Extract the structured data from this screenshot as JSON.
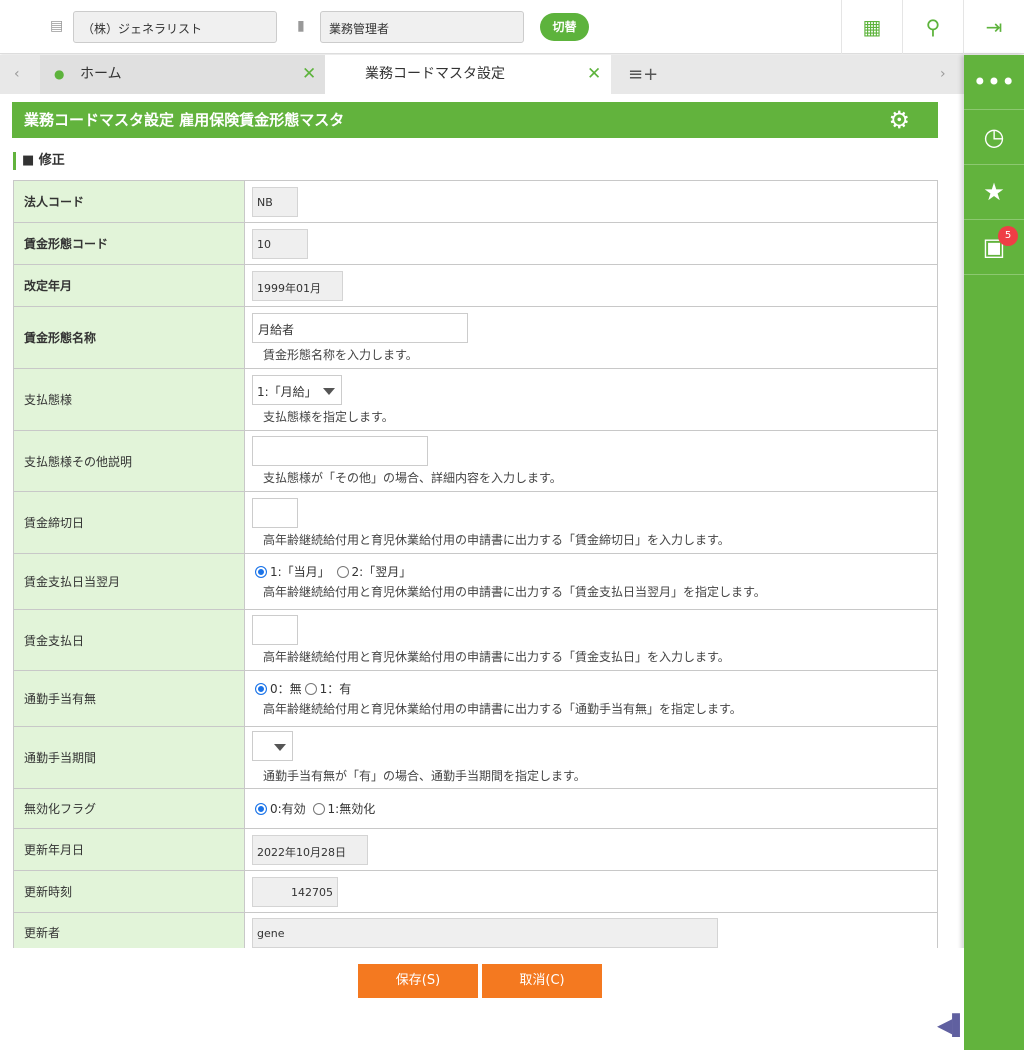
{
  "header": {
    "company": "（株）ジェネラリスト",
    "role": "業務管理者",
    "switch_label": "切替"
  },
  "tabs": [
    {
      "label": "ホーム"
    },
    {
      "label": "業務コードマスタ設定"
    }
  ],
  "sidebar": {
    "notification_count": "5"
  },
  "page": {
    "title": "業務コードマスタ設定 雇用保険賃金形態マスタ",
    "section": "■ 修正"
  },
  "form": {
    "corp_code": {
      "label": "法人コード",
      "value": "NB"
    },
    "wage_code": {
      "label": "賃金形態コード",
      "value": "10"
    },
    "revision": {
      "label": "改定年月",
      "value": "1999年01月"
    },
    "wage_name": {
      "label": "賃金形態名称",
      "value": "月給者",
      "hint": "賃金形態名称を入力します。"
    },
    "payment_mode": {
      "label": "支払態様",
      "value": "1:「月給」",
      "hint": "支払態様を指定します。"
    },
    "payment_other": {
      "label": "支払態様その他説明",
      "value": "",
      "hint": "支払態様が「その他」の場合、詳細内容を入力します。"
    },
    "closing_day": {
      "label": "賃金締切日",
      "value": "",
      "hint": "高年齢継続給付用と育児休業給付用の申請書に出力する「賃金締切日」を入力します。"
    },
    "pay_month": {
      "label": "賃金支払日当翌月",
      "options": [
        "1:「当月」",
        "2:「翌月」"
      ],
      "selected": 0,
      "hint": "高年齢継続給付用と育児休業給付用の申請書に出力する「賃金支払日当翌月」を指定します。"
    },
    "pay_day": {
      "label": "賃金支払日",
      "value": "",
      "hint": "高年齢継続給付用と育児休業給付用の申請書に出力する「賃金支払日」を入力します。"
    },
    "commute": {
      "label": "通勤手当有無",
      "options": [
        "0：無",
        "1：有"
      ],
      "selected": 0,
      "hint": "高年齢継続給付用と育児休業給付用の申請書に出力する「通勤手当有無」を指定します。"
    },
    "commute_period": {
      "label": "通勤手当期間",
      "value": "",
      "hint": "通勤手当有無が「有」の場合、通勤手当期間を指定します。"
    },
    "disable_flag": {
      "label": "無効化フラグ",
      "options": [
        "0:有効",
        "1:無効化"
      ],
      "selected": 0
    },
    "updated_date": {
      "label": "更新年月日",
      "value": "2022年10月28日"
    },
    "updated_time": {
      "label": "更新時刻",
      "value": "142705"
    },
    "updated_by": {
      "label": "更新者",
      "value": "gene"
    }
  },
  "buttons": {
    "save": "保存(S)",
    "cancel": "取消(C)"
  }
}
